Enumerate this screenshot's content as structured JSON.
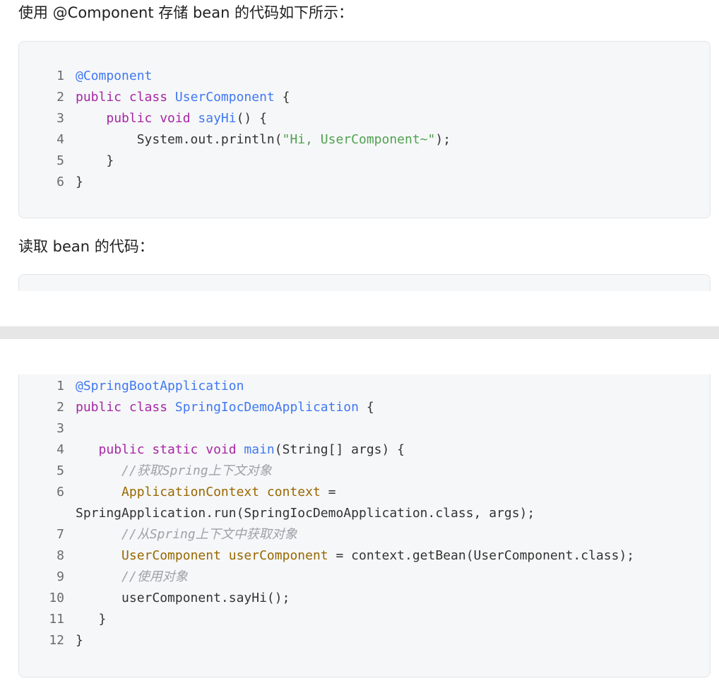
{
  "intro_text": "使用 @Component 存储 bean 的代码如下所示：",
  "read_text": "读取 bean 的代码：",
  "code_block_1": {
    "lines": [
      {
        "n": "1",
        "tokens": [
          {
            "t": "@Component",
            "c": "ty"
          }
        ]
      },
      {
        "n": "2",
        "tokens": [
          {
            "t": "public class ",
            "c": "kw"
          },
          {
            "t": "UserComponent",
            "c": "ty"
          },
          {
            "t": " {",
            "c": "tx"
          }
        ]
      },
      {
        "n": "3",
        "tokens": [
          {
            "t": "    ",
            "c": "tx"
          },
          {
            "t": "public void ",
            "c": "kw"
          },
          {
            "t": "sayHi",
            "c": "ty"
          },
          {
            "t": "() {",
            "c": "tx"
          }
        ]
      },
      {
        "n": "4",
        "tokens": [
          {
            "t": "        System.out.println(",
            "c": "tx"
          },
          {
            "t": "\"Hi, UserComponent~\"",
            "c": "st"
          },
          {
            "t": ");",
            "c": "tx"
          }
        ]
      },
      {
        "n": "5",
        "tokens": [
          {
            "t": "    }",
            "c": "tx"
          }
        ]
      },
      {
        "n": "6",
        "tokens": [
          {
            "t": "}",
            "c": "tx"
          }
        ]
      }
    ]
  },
  "code_block_2": {
    "lines": [
      {
        "n": "1",
        "tokens": [
          {
            "t": "@SpringBootApplication",
            "c": "ty"
          }
        ]
      },
      {
        "n": "2",
        "tokens": [
          {
            "t": "public class ",
            "c": "kw"
          },
          {
            "t": "SpringIocDemoApplication",
            "c": "ty"
          },
          {
            "t": " {",
            "c": "tx"
          }
        ]
      },
      {
        "n": "3",
        "tokens": []
      },
      {
        "n": "4",
        "tokens": [
          {
            "t": "   ",
            "c": "tx"
          },
          {
            "t": "public static void ",
            "c": "kw"
          },
          {
            "t": "main",
            "c": "ty"
          },
          {
            "t": "(String[] args) {",
            "c": "tx"
          }
        ]
      },
      {
        "n": "5",
        "tokens": [
          {
            "t": "      ",
            "c": "tx"
          },
          {
            "t": "//获取Spring上下文对象",
            "c": "cm"
          }
        ]
      },
      {
        "n": "6",
        "tokens": [
          {
            "t": "      ",
            "c": "tx"
          },
          {
            "t": "ApplicationContext context",
            "c": "va"
          },
          {
            "t": " =",
            "c": "tx"
          }
        ],
        "wrap": "SpringApplication.run(SpringIocDemoApplication.class, args);"
      },
      {
        "n": "7",
        "tokens": [
          {
            "t": "      ",
            "c": "tx"
          },
          {
            "t": "//从Spring上下文中获取对象",
            "c": "cm"
          }
        ]
      },
      {
        "n": "8",
        "tokens": [
          {
            "t": "      ",
            "c": "tx"
          },
          {
            "t": "UserComponent userComponent",
            "c": "va"
          },
          {
            "t": " = context.getBean(UserComponent.class);",
            "c": "tx"
          }
        ]
      },
      {
        "n": "9",
        "tokens": [
          {
            "t": "      ",
            "c": "tx"
          },
          {
            "t": "//使用对象",
            "c": "cm"
          }
        ]
      },
      {
        "n": "10",
        "tokens": [
          {
            "t": "      userComponent.sayHi();",
            "c": "tx"
          }
        ]
      },
      {
        "n": "11",
        "tokens": [
          {
            "t": "   }",
            "c": "tx"
          }
        ]
      },
      {
        "n": "12",
        "tokens": [
          {
            "t": "}",
            "c": "tx"
          }
        ]
      }
    ]
  }
}
